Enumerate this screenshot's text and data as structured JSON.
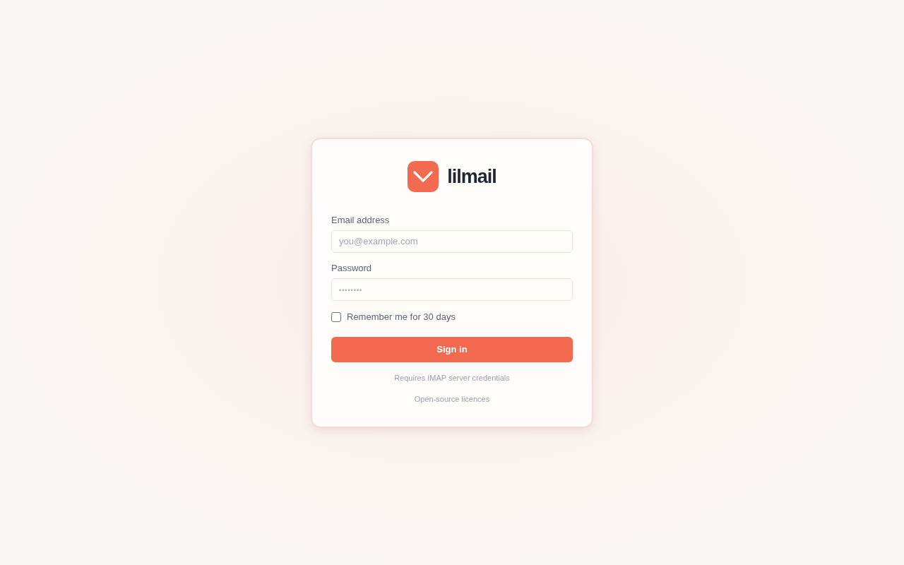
{
  "brand": {
    "name": "lilmail"
  },
  "form": {
    "fields": [
      {
        "kind": "email",
        "label": "Email address",
        "placeholder": "you@example.com"
      },
      {
        "kind": "password",
        "label": "Password",
        "placeholder": "••••••••"
      }
    ],
    "remember": {
      "label": "Remember me for 30 days",
      "checked": false
    },
    "submit": {
      "label": "Sign in"
    }
  },
  "note": "Requires IMAP server credentials",
  "link": "Open-source licences"
}
